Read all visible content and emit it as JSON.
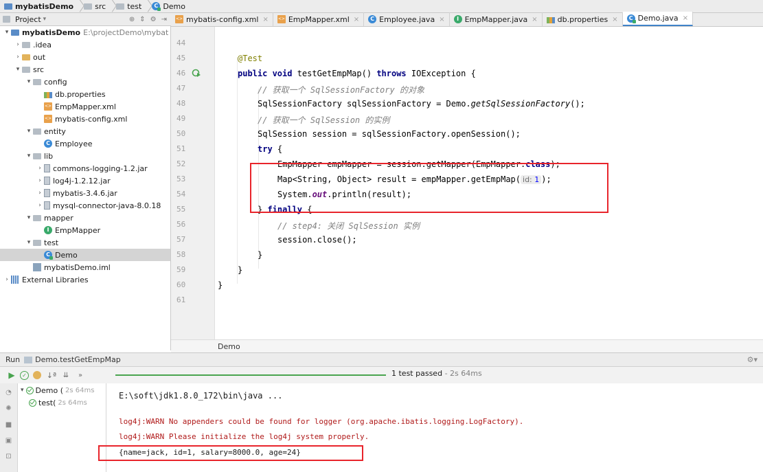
{
  "breadcrumb": [
    "mybatisDemo",
    "src",
    "test",
    "Demo"
  ],
  "project_panel": {
    "title": "Project",
    "tree": [
      {
        "label": "mybatisDemo",
        "path": "E:\\projectDemo\\mybat",
        "level": 0,
        "arrow": "down",
        "icon": "project-folder"
      },
      {
        "label": ".idea",
        "level": 1,
        "arrow": "right",
        "icon": "folder"
      },
      {
        "label": "out",
        "level": 1,
        "arrow": "right",
        "icon": "folder-orange"
      },
      {
        "label": "src",
        "level": 1,
        "arrow": "down",
        "icon": "folder"
      },
      {
        "label": "config",
        "level": 2,
        "arrow": "down",
        "icon": "folder"
      },
      {
        "label": "db.properties",
        "level": 3,
        "arrow": "",
        "icon": "properties-file"
      },
      {
        "label": "EmpMapper.xml",
        "level": 3,
        "arrow": "",
        "icon": "xml-file"
      },
      {
        "label": "mybatis-config.xml",
        "level": 3,
        "arrow": "",
        "icon": "xml-file"
      },
      {
        "label": "entity",
        "level": 2,
        "arrow": "down",
        "icon": "folder"
      },
      {
        "label": "Employee",
        "level": 3,
        "arrow": "",
        "icon": "class"
      },
      {
        "label": "lib",
        "level": 2,
        "arrow": "down",
        "icon": "folder"
      },
      {
        "label": "commons-logging-1.2.jar",
        "level": 3,
        "arrow": "right",
        "icon": "jar"
      },
      {
        "label": "log4j-1.2.12.jar",
        "level": 3,
        "arrow": "right",
        "icon": "jar"
      },
      {
        "label": "mybatis-3.4.6.jar",
        "level": 3,
        "arrow": "right",
        "icon": "jar"
      },
      {
        "label": "mysql-connector-java-8.0.18",
        "level": 3,
        "arrow": "right",
        "icon": "jar"
      },
      {
        "label": "mapper",
        "level": 2,
        "arrow": "down",
        "icon": "folder"
      },
      {
        "label": "EmpMapper",
        "level": 3,
        "arrow": "",
        "icon": "interface"
      },
      {
        "label": "test",
        "level": 2,
        "arrow": "down",
        "icon": "folder"
      },
      {
        "label": "Demo",
        "level": 3,
        "arrow": "",
        "icon": "test-class",
        "selected": true
      },
      {
        "label": "mybatisDemo.iml",
        "level": 2,
        "arrow": "",
        "icon": "iml-file"
      },
      {
        "label": "External Libraries",
        "level": 0,
        "arrow": "right",
        "icon": "libraries"
      }
    ]
  },
  "tabs": [
    {
      "label": "mybatis-config.xml",
      "icon": "xml-file",
      "active": false
    },
    {
      "label": "EmpMapper.xml",
      "icon": "xml-file",
      "active": false
    },
    {
      "label": "Employee.java",
      "icon": "class",
      "active": false
    },
    {
      "label": "EmpMapper.java",
      "icon": "interface",
      "active": false
    },
    {
      "label": "db.properties",
      "icon": "properties-file",
      "active": false
    },
    {
      "label": "Demo.java",
      "icon": "test-class",
      "active": true
    }
  ],
  "editor": {
    "line_numbers": [
      "44",
      "45",
      "46",
      "47",
      "48",
      "49",
      "50",
      "51",
      "52",
      "53",
      "54",
      "55",
      "56",
      "57",
      "58",
      "59",
      "60",
      "61"
    ],
    "code": {
      "l45": "@Test",
      "l46_kw1": "public void",
      "l46_mid": " testGetEmpMap() ",
      "l46_kw2": "throws",
      "l46_end": " IOException {",
      "l47": "// 获取一个 SqlSessionFactory 的对象",
      "l48_a": "SqlSessionFactory sqlSessionFactory = Demo.",
      "l48_b": "getSqlSessionFactory",
      "l48_c": "();",
      "l49": "// 获取一个 SqlSession 的实例",
      "l50": "SqlSession session = sqlSessionFactory.openSession();",
      "l51_kw": "try",
      "l51_end": " {",
      "l52_a": "EmpMapper empMapper = session.getMapper(EmpMapper.",
      "l52_kw": "class",
      "l52_c": ");",
      "l53_a": "Map<String, Object> result = empMapper.getEmpMap(",
      "l53_hint": "id:",
      "l53_val": "1",
      "l53_c": ");",
      "l54_a": "System.",
      "l54_field": "out",
      "l54_c": ".println(result);",
      "l55_a": "} ",
      "l55_kw": "finally",
      "l55_c": " {",
      "l56": "// step4: 关闭 SqlSession 实例",
      "l57": "session.close();",
      "l58": "}",
      "l59": "}",
      "l60": "}"
    },
    "footer_breadcrumb": "Demo"
  },
  "run_panel": {
    "header": "Run",
    "config_name": "Demo.testGetEmpMap",
    "status": "1 test passed",
    "status_time": "- 2s 64ms",
    "progress": 1.0,
    "tree": [
      {
        "label": "Demo (",
        "time": "2s 64ms"
      },
      {
        "label": "test(",
        "time": "2s 64ms"
      }
    ],
    "console": [
      "E:\\soft\\jdk1.8.0_172\\bin\\java ...",
      "log4j:WARN No appenders could be found for logger (org.apache.ibatis.logging.LogFactory).",
      "log4j:WARN Please initialize the log4j system properly.",
      "{name=jack, id=1, salary=8000.0, age=24}"
    ]
  },
  "colors": {
    "highlight_box": "#e8242b",
    "pass_green": "#49a44f",
    "keyword": "#000080",
    "comment": "#808080",
    "annotation": "#808000",
    "warn": "#b01a1a"
  }
}
